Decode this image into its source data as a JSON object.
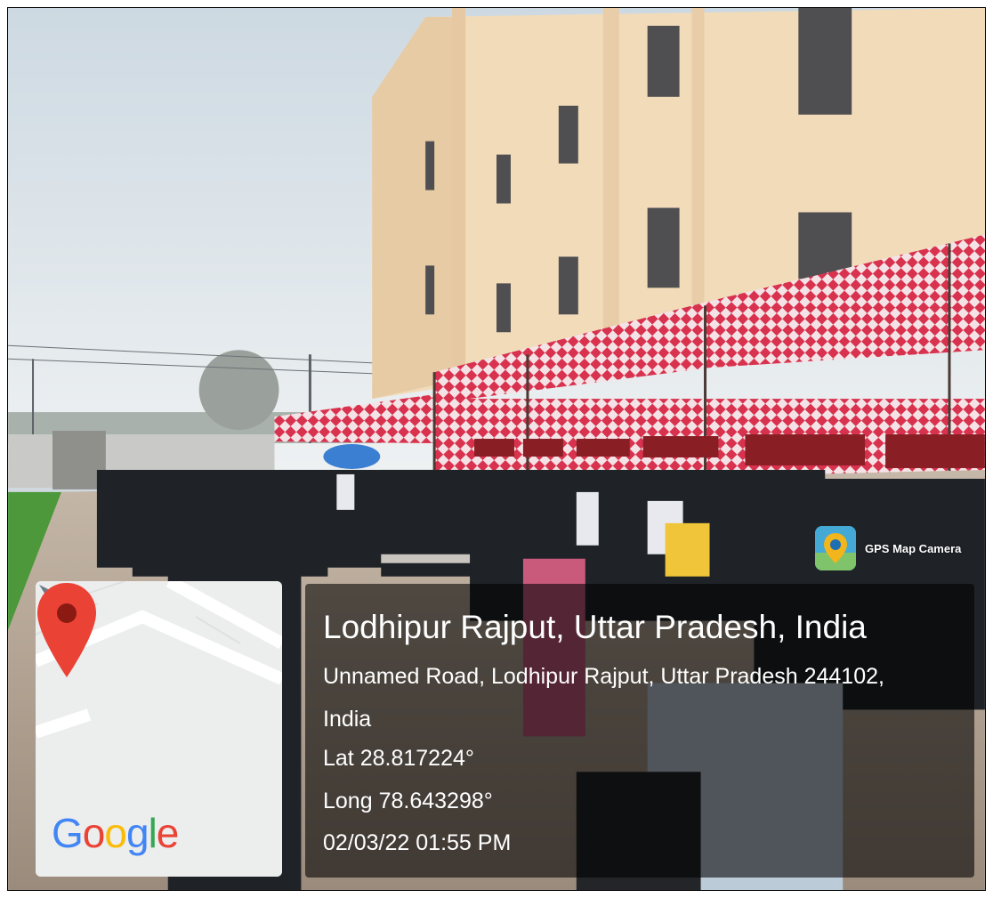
{
  "overlay": {
    "app_name": "GPS Map Camera",
    "place_title": "Lodhipur Rajput, Uttar Pradesh, India",
    "address_line1": "Unnamed Road, Lodhipur Rajput, Uttar Pradesh 244102,",
    "address_line2": "India",
    "lat_label": "Lat",
    "lat_value": "28.817224°",
    "long_label": "Long",
    "long_value": "78.643298°",
    "timestamp": "02/03/22 01:55 PM"
  },
  "map": {
    "logo_letters": [
      "G",
      "o",
      "o",
      "g",
      "l",
      "e"
    ],
    "logo_colors": [
      "#4285F4",
      "#EA4335",
      "#FBBC05",
      "#4285F4",
      "#34A853",
      "#EA4335"
    ],
    "pin_color": "#EA4335",
    "icon": "map-pin-icon"
  },
  "scene_colors": {
    "sky": "#dfe6ea",
    "building": "#f2dcbc",
    "canopy": "#e0405a",
    "ground": "#b9a898",
    "field": "#4f9a3a"
  }
}
